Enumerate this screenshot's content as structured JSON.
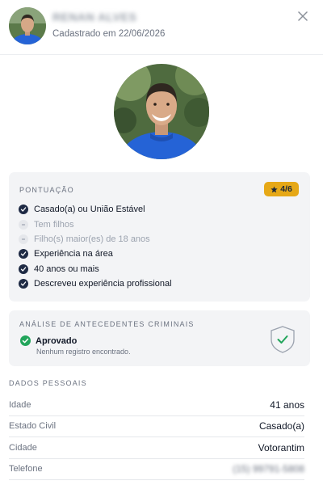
{
  "header": {
    "name": "RENAN ALVES",
    "registered": "Cadastrado em 22/06/2026",
    "close_icon": "close-icon"
  },
  "score": {
    "title": "PONTUAÇÃO",
    "badge_icon": "star",
    "badge_value": "4/6",
    "criteria": [
      {
        "label": "Casado(a) ou União Estável",
        "met": true
      },
      {
        "label": "Tem filhos",
        "met": false
      },
      {
        "label": "Filho(s) maior(es) de 18 anos",
        "met": false
      },
      {
        "label": "Experiência na área",
        "met": true
      },
      {
        "label": "40 anos ou mais",
        "met": true
      },
      {
        "label": "Descreveu experiência profissional",
        "met": true
      }
    ]
  },
  "background_check": {
    "title": "ANÁLISE DE ANTECEDENTES CRIMINAIS",
    "status": "Aprovado",
    "description": "Nenhum registro encontrado."
  },
  "personal": {
    "title": "DADOS PESSOAIS",
    "rows": [
      {
        "label": "Idade",
        "value": "41 anos"
      },
      {
        "label": "Estado Civil",
        "value": "Casado(a)"
      },
      {
        "label": "Cidade",
        "value": "Votorantim"
      },
      {
        "label": "Telefone",
        "value": "(15) 99791-5808"
      }
    ]
  },
  "colors": {
    "badge": "#e6a817",
    "check": "#1e2a44",
    "approved": "#22a55b",
    "shirt": "#2563d6"
  }
}
